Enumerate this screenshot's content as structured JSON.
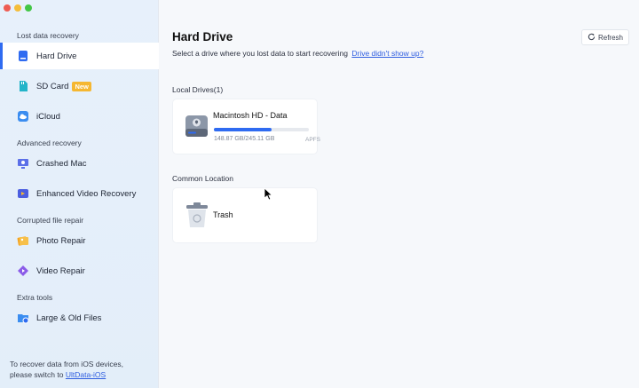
{
  "sidebar": {
    "sections": {
      "lost": "Lost data recovery",
      "advanced": "Advanced recovery",
      "corrupted": "Corrupted file repair",
      "extra": "Extra tools"
    },
    "items": [
      {
        "label": "Hard Drive",
        "icon": "hard-drive-icon",
        "active": true
      },
      {
        "label": "SD Card",
        "icon": "sd-card-icon",
        "badge": "New"
      },
      {
        "label": "iCloud",
        "icon": "icloud-icon"
      },
      {
        "label": "Crashed Mac",
        "icon": "crashed-mac-icon"
      },
      {
        "label": "Enhanced Video Recovery",
        "icon": "video-recovery-icon"
      },
      {
        "label": "Photo Repair",
        "icon": "photo-repair-icon"
      },
      {
        "label": "Video Repair",
        "icon": "video-repair-icon"
      },
      {
        "label": "Large & Old Files",
        "icon": "large-files-icon"
      }
    ],
    "footer": {
      "line1": "To recover data from iOS devices,",
      "line2": "please switch to",
      "link": "UltData-iOS"
    }
  },
  "main": {
    "title": "Hard Drive",
    "subtitle": "Select a drive where you lost data to start recovering",
    "help_link": "Drive didn't show up?",
    "refresh_label": "Refresh",
    "local_drives_label": "Local Drives(1)",
    "drive": {
      "name": "Macintosh HD - Data",
      "size": "148.87 GB/245.11 GB",
      "filesystem": "APFS",
      "used_fraction": 0.61
    },
    "common_location_label": "Common Location",
    "trash_label": "Trash"
  },
  "colors": {
    "accent": "#2f6bf1",
    "badge": "#f5b731"
  }
}
